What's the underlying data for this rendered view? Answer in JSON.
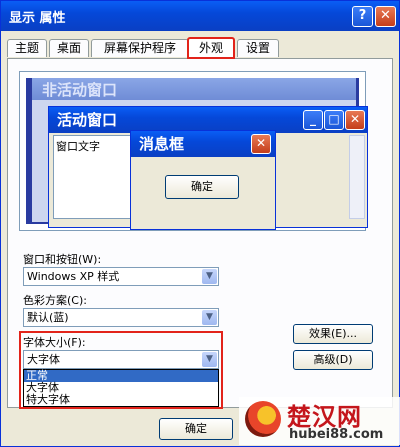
{
  "window": {
    "title": "显示 属性",
    "help": "?",
    "close": "✕"
  },
  "tabs": [
    {
      "label": "主题"
    },
    {
      "label": "桌面"
    },
    {
      "label": "屏幕保护程序"
    },
    {
      "label": "外观",
      "active": true
    },
    {
      "label": "设置"
    }
  ],
  "preview": {
    "inactive_title": "非活动窗口",
    "active_title": "活动窗口",
    "window_text": "窗口文字",
    "message_title": "消息框",
    "message_ok": "确定",
    "min": "_",
    "max": "□",
    "close": "✕"
  },
  "form": {
    "windows_buttons_label": "窗口和按钮(W):",
    "windows_buttons_value": "Windows XP 样式",
    "color_scheme_label": "色彩方案(C):",
    "color_scheme_value": "默认(蓝)",
    "font_size_label": "字体大小(F):",
    "font_size_value": "大字体",
    "font_size_options": [
      "正常",
      "大字体",
      "特大字体"
    ]
  },
  "buttons": {
    "effects": "效果(E)...",
    "advanced": "高级(D)",
    "ok": "确定"
  },
  "watermark": {
    "brand": "楚汉网",
    "site": "hubei88.com"
  },
  "colors": {
    "accent": "#0a5ef5",
    "highlight": "#e2231a",
    "selected": "#316ac5"
  }
}
